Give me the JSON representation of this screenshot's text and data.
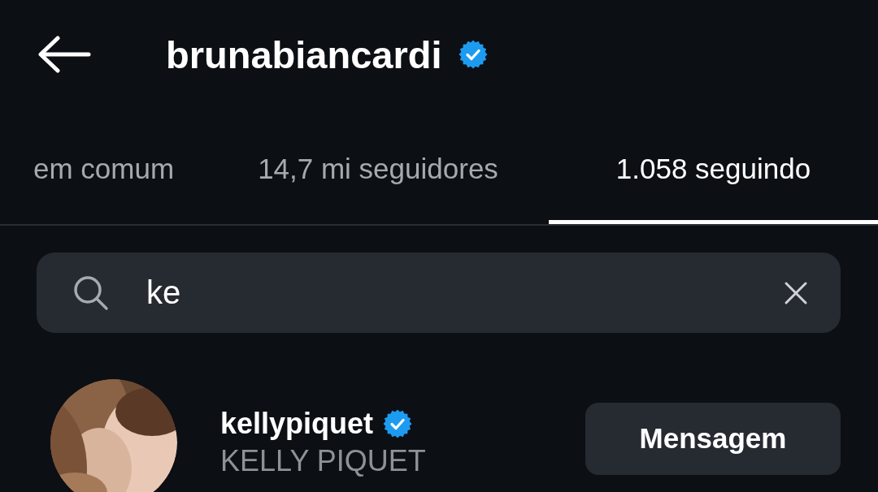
{
  "header": {
    "title": "brunabiancardi",
    "verified": true
  },
  "tabs": [
    {
      "label": "em comum",
      "selected": false
    },
    {
      "label": "14,7 mi seguidores",
      "selected": false
    },
    {
      "label": "1.058 seguindo",
      "selected": true
    }
  ],
  "search": {
    "value": "ke"
  },
  "results": [
    {
      "username": "kellypiquet",
      "verified": true,
      "full_name": "KELLY PIQUET",
      "button": "Mensagem"
    }
  ]
}
